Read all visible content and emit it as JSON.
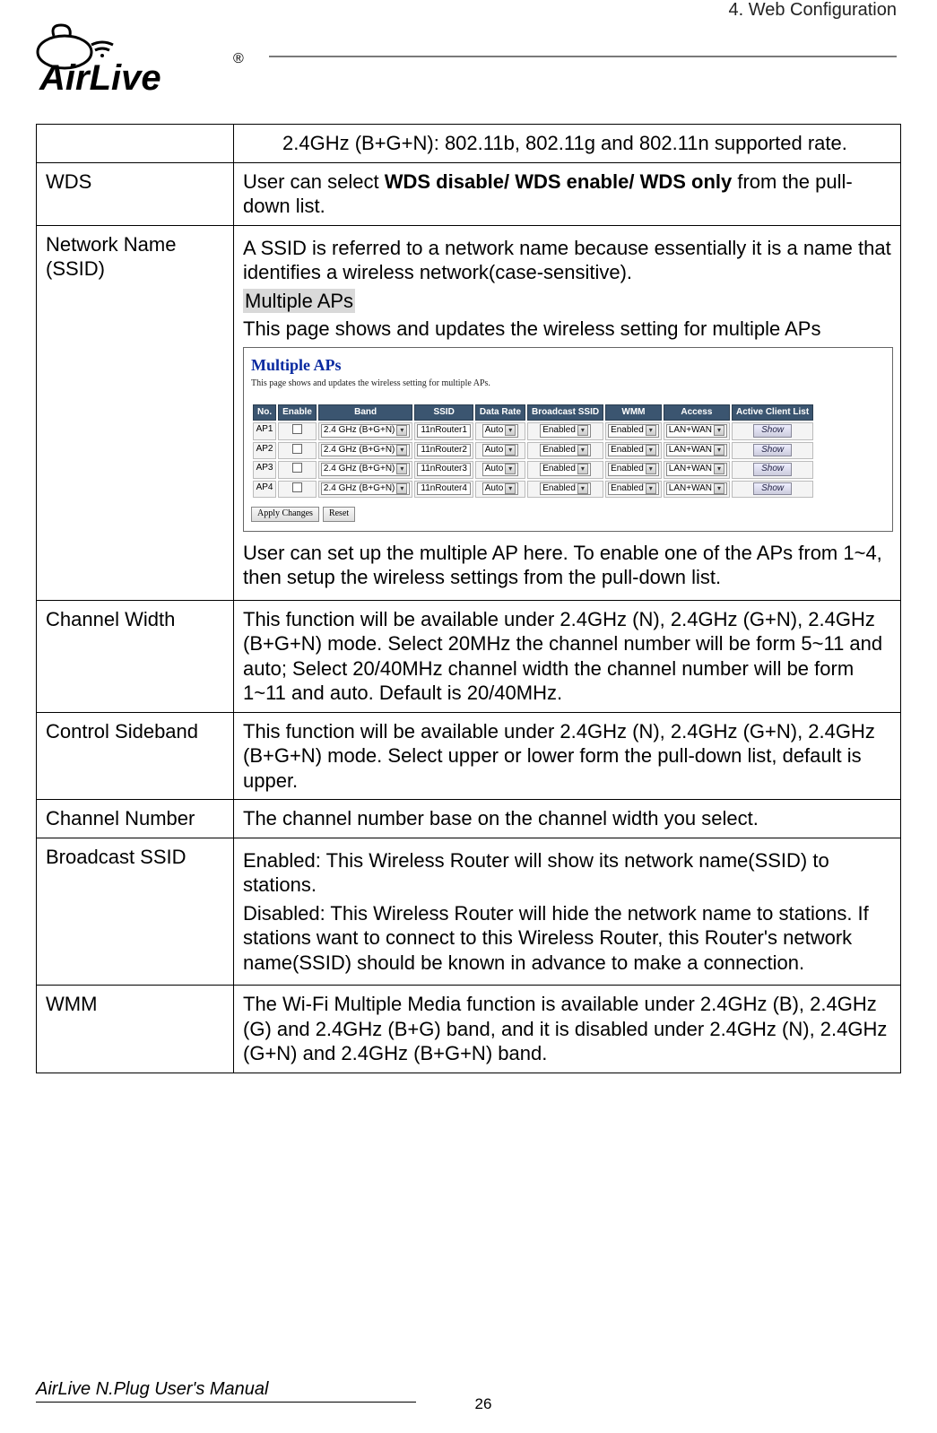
{
  "chapter_title": "4. Web Configuration",
  "logo": {
    "brand": "AirLive",
    "mark": "®"
  },
  "rows": [
    {
      "label": "",
      "content": {
        "type": "first_row",
        "text": "2.4GHz (B+G+N): 802.11b, 802.11g and 802.11n supported rate."
      }
    },
    {
      "label": "WDS",
      "content": {
        "type": "wds",
        "pre": "User can select ",
        "bold": "WDS disable/ WDS enable/ WDS only",
        "post": " from the pull-down list."
      }
    },
    {
      "label": "Network Name (SSID)",
      "content": {
        "type": "ssid",
        "p1": "A SSID is referred to a network name because essentially it is a name that identifies a wireless network(case-sensitive).",
        "highlight": "Multiple APs",
        "p2": "This page shows and updates the wireless setting for multiple APs",
        "screenshot": {
          "title": "Multiple APs",
          "subtitle": "This page shows and updates the wireless setting for multiple APs.",
          "headers": [
            "No.",
            "Enable",
            "Band",
            "SSID",
            "Data Rate",
            "Broadcast SSID",
            "WMM",
            "Access",
            "Active Client List"
          ],
          "rows": [
            {
              "no": "AP1",
              "band": "2.4 GHz (B+G+N)",
              "ssid": "11nRouter1",
              "rate": "Auto",
              "bcast": "Enabled",
              "wmm": "Enabled",
              "access": "LAN+WAN",
              "show": "Show"
            },
            {
              "no": "AP2",
              "band": "2.4 GHz (B+G+N)",
              "ssid": "11nRouter2",
              "rate": "Auto",
              "bcast": "Enabled",
              "wmm": "Enabled",
              "access": "LAN+WAN",
              "show": "Show"
            },
            {
              "no": "AP3",
              "band": "2.4 GHz (B+G+N)",
              "ssid": "11nRouter3",
              "rate": "Auto",
              "bcast": "Enabled",
              "wmm": "Enabled",
              "access": "LAN+WAN",
              "show": "Show"
            },
            {
              "no": "AP4",
              "band": "2.4 GHz (B+G+N)",
              "ssid": "11nRouter4",
              "rate": "Auto",
              "bcast": "Enabled",
              "wmm": "Enabled",
              "access": "LAN+WAN",
              "show": "Show"
            }
          ],
          "btn_apply": "Apply Changes",
          "btn_reset": "Reset"
        },
        "p3": "User can set up the multiple AP here. To enable one of the APs from 1~4, then setup the wireless settings from the pull-down list."
      }
    },
    {
      "label": "Channel Width",
      "content": {
        "type": "plain",
        "text": "This function will be available under 2.4GHz (N), 2.4GHz (G+N), 2.4GHz (B+G+N) mode. Select 20MHz the channel number will be form 5~11 and auto; Select 20/40MHz channel width the channel number will be form 1~11 and auto. Default is 20/40MHz."
      }
    },
    {
      "label": "Control Sideband",
      "content": {
        "type": "plain",
        "text": "This function will be available under 2.4GHz (N), 2.4GHz (G+N), 2.4GHz (B+G+N) mode. Select upper or lower form the pull-down list, default is upper."
      }
    },
    {
      "label": "Channel Number",
      "content": {
        "type": "plain",
        "text": "The channel number base on the channel width you select."
      }
    },
    {
      "label": "Broadcast SSID",
      "content": {
        "type": "multi",
        "paras": [
          "Enabled: This Wireless Router will show its network name(SSID) to stations.",
          "Disabled: This Wireless Router will hide the network name to stations. If stations want to connect to this Wireless Router, this Router's network name(SSID) should be known in advance to make a connection."
        ]
      }
    },
    {
      "label": "WMM",
      "content": {
        "type": "plain",
        "text": "The Wi-Fi Multiple Media function is available under 2.4GHz (B), 2.4GHz (G) and 2.4GHz (B+G) band, and it is disabled under 2.4GHz (N), 2.4GHz (G+N) and 2.4GHz (B+G+N) band."
      }
    }
  ],
  "footer": {
    "manual": "AirLive N.Plug User's Manual",
    "page": "26"
  }
}
